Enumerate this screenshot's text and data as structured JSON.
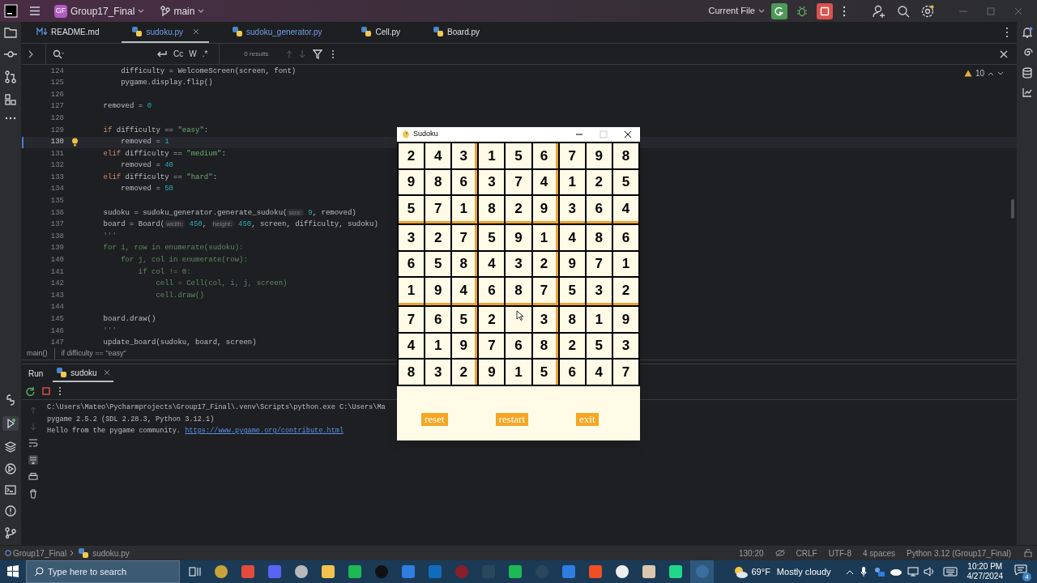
{
  "titlebar": {
    "project_badge": "GF",
    "project": "Group17_Final",
    "branch": "main",
    "run_config": "Current File"
  },
  "tabs": [
    {
      "label": "README.md",
      "kind": "markdown",
      "selected": false
    },
    {
      "label": "sudoku.py",
      "kind": "python",
      "selected": true
    },
    {
      "label": "sudoku_generator.py",
      "kind": "python",
      "selected": false
    },
    {
      "label": "Cell.py",
      "kind": "python",
      "selected": false
    },
    {
      "label": "Board.py",
      "kind": "python",
      "selected": false
    }
  ],
  "find_bar": {
    "options": [
      "Cc",
      "W",
      ".*"
    ],
    "results": "0 results"
  },
  "editor": {
    "warnings": "10",
    "lines": [
      {
        "number": "124",
        "tokens": [
          {
            "kind": "code",
            "text": "        difficulty = WelcomeScreen(screen, font)"
          }
        ]
      },
      {
        "number": "125",
        "tokens": [
          {
            "kind": "code",
            "text": "        pygame.display.flip()"
          }
        ]
      },
      {
        "number": "126"
      },
      {
        "number": "127",
        "tokens": [
          {
            "kind": "code",
            "text": "    removed = "
          },
          {
            "kind": "number",
            "text": "0"
          }
        ]
      },
      {
        "number": "128"
      },
      {
        "number": "129",
        "tokens": [
          {
            "kind": "keyword",
            "text": "    if"
          },
          {
            "kind": "code",
            "text": " difficulty == "
          },
          {
            "kind": "string",
            "text": "\"easy\""
          },
          {
            "kind": "code",
            "text": ":"
          }
        ]
      },
      {
        "number": "130",
        "current": true,
        "tokens": [
          {
            "kind": "code",
            "text": "        removed = "
          },
          {
            "kind": "number",
            "text": "1"
          }
        ]
      },
      {
        "number": "131",
        "tokens": [
          {
            "kind": "keyword",
            "text": "    elif"
          },
          {
            "kind": "code",
            "text": " difficulty == "
          },
          {
            "kind": "string",
            "text": "\"medium\""
          },
          {
            "kind": "code",
            "text": ":"
          }
        ]
      },
      {
        "number": "132",
        "tokens": [
          {
            "kind": "code",
            "text": "        removed = "
          },
          {
            "kind": "number",
            "text": "40"
          }
        ]
      },
      {
        "number": "133",
        "tokens": [
          {
            "kind": "keyword",
            "text": "    elif"
          },
          {
            "kind": "code",
            "text": " difficulty == "
          },
          {
            "kind": "string",
            "text": "\"hard\""
          },
          {
            "kind": "code",
            "text": ":"
          }
        ]
      },
      {
        "number": "134",
        "tokens": [
          {
            "kind": "code",
            "text": "        removed = "
          },
          {
            "kind": "number",
            "text": "50"
          }
        ]
      },
      {
        "number": "135"
      },
      {
        "number": "136",
        "tokens": [
          {
            "kind": "code",
            "text": "    sudoku = sudoku_generator.generate_sudoku("
          },
          {
            "kind": "hint",
            "text": "size:"
          },
          {
            "kind": "number",
            "text": " 9"
          },
          {
            "kind": "code",
            "text": ", removed)"
          }
        ]
      },
      {
        "number": "137",
        "tokens": [
          {
            "kind": "code",
            "text": "    board = Board("
          },
          {
            "kind": "hint",
            "text": "width:"
          },
          {
            "kind": "number",
            "text": " 450"
          },
          {
            "kind": "code",
            "text": ", "
          },
          {
            "kind": "hint",
            "text": "height:"
          },
          {
            "kind": "number",
            "text": " 450"
          },
          {
            "kind": "code",
            "text": ", screen, difficulty, sudoku)"
          }
        ]
      },
      {
        "number": "138",
        "tokens": [
          {
            "kind": "docstring",
            "text": "    '''"
          }
        ]
      },
      {
        "number": "139",
        "tokens": [
          {
            "kind": "docstring",
            "text": "    for i, row in enumerate(sudoku):"
          }
        ]
      },
      {
        "number": "140",
        "tokens": [
          {
            "kind": "docstring",
            "text": "        for j, col in enumerate(row):"
          }
        ]
      },
      {
        "number": "141",
        "tokens": [
          {
            "kind": "docstring",
            "text": "            if col != 0:"
          }
        ]
      },
      {
        "number": "142",
        "tokens": [
          {
            "kind": "docstring",
            "text": "                cell = Cell(col, i, j, screen)"
          }
        ]
      },
      {
        "number": "143",
        "tokens": [
          {
            "kind": "docstring",
            "text": "                cell.draw()"
          }
        ]
      },
      {
        "number": "144"
      },
      {
        "number": "145",
        "tokens": [
          {
            "kind": "code",
            "text": "    board.draw()"
          }
        ]
      },
      {
        "number": "146",
        "tokens": [
          {
            "kind": "docstring",
            "text": "    '''"
          }
        ]
      },
      {
        "number": "147",
        "tokens": [
          {
            "kind": "code",
            "text": "    update_board(sudoku, board, screen)"
          }
        ]
      }
    ]
  },
  "breadcrumb": [
    "main()",
    "if difficulty == \"easy\""
  ],
  "run_panel": {
    "tabs": [
      {
        "label": "Run",
        "kind": "title"
      },
      {
        "label": "sudoku",
        "kind": "config"
      }
    ],
    "console": [
      [
        {
          "kind": "text",
          "text": "C:\\Users\\Mateo\\Pycharmprojects\\Group17_Final\\.venv\\Scripts\\python.exe C:\\Users\\Ma"
        }
      ],
      [
        {
          "kind": "text",
          "text": "pygame 2.5.2 (SDL 2.28.3, Python 3.12.1)"
        }
      ],
      [
        {
          "kind": "text",
          "text": "Hello from the pygame community. "
        },
        {
          "kind": "link",
          "text": "https://www.pygame.org/contribute.html"
        }
      ]
    ]
  },
  "status_bar": {
    "path": [
      "Group17_Final",
      "sudoku.py"
    ],
    "items": [
      "130:20",
      "CRLF",
      "UTF-8",
      "4 spaces",
      "Python 3.12 (Group17_Final)"
    ]
  },
  "sudoku_window": {
    "title": "Sudoku",
    "grid": [
      [
        {
          "kind": "digit",
          "value": "2"
        },
        {
          "kind": "digit",
          "value": "4"
        },
        {
          "kind": "digit",
          "value": "3"
        },
        {
          "kind": "digit",
          "value": "1"
        },
        {
          "kind": "digit",
          "value": "5"
        },
        {
          "kind": "digit",
          "value": "6"
        },
        {
          "kind": "digit",
          "value": "7"
        },
        {
          "kind": "digit",
          "value": "9"
        },
        {
          "kind": "digit",
          "value": "8"
        }
      ],
      [
        {
          "kind": "digit",
          "value": "9"
        },
        {
          "kind": "digit",
          "value": "8"
        },
        {
          "kind": "digit",
          "value": "6"
        },
        {
          "kind": "digit",
          "value": "3"
        },
        {
          "kind": "digit",
          "value": "7"
        },
        {
          "kind": "digit",
          "value": "4"
        },
        {
          "kind": "digit",
          "value": "1"
        },
        {
          "kind": "digit",
          "value": "2"
        },
        {
          "kind": "digit",
          "value": "5"
        }
      ],
      [
        {
          "kind": "digit",
          "value": "5"
        },
        {
          "kind": "digit",
          "value": "7"
        },
        {
          "kind": "digit",
          "value": "1"
        },
        {
          "kind": "digit",
          "value": "8"
        },
        {
          "kind": "digit",
          "value": "2"
        },
        {
          "kind": "digit",
          "value": "9"
        },
        {
          "kind": "digit",
          "value": "3"
        },
        {
          "kind": "digit",
          "value": "6"
        },
        {
          "kind": "digit",
          "value": "4"
        }
      ],
      [
        {
          "kind": "digit",
          "value": "3"
        },
        {
          "kind": "digit",
          "value": "2"
        },
        {
          "kind": "digit",
          "value": "7"
        },
        {
          "kind": "digit",
          "value": "5"
        },
        {
          "kind": "digit",
          "value": "9"
        },
        {
          "kind": "digit",
          "value": "1"
        },
        {
          "kind": "digit",
          "value": "4"
        },
        {
          "kind": "digit",
          "value": "8"
        },
        {
          "kind": "digit",
          "value": "6"
        }
      ],
      [
        {
          "kind": "digit",
          "value": "6"
        },
        {
          "kind": "digit",
          "value": "5"
        },
        {
          "kind": "digit",
          "value": "8"
        },
        {
          "kind": "digit",
          "value": "4"
        },
        {
          "kind": "digit",
          "value": "3"
        },
        {
          "kind": "digit",
          "value": "2"
        },
        {
          "kind": "digit",
          "value": "9"
        },
        {
          "kind": "digit",
          "value": "7"
        },
        {
          "kind": "digit",
          "value": "1"
        }
      ],
      [
        {
          "kind": "digit",
          "value": "1"
        },
        {
          "kind": "digit",
          "value": "9"
        },
        {
          "kind": "digit",
          "value": "4"
        },
        {
          "kind": "digit",
          "value": "6"
        },
        {
          "kind": "digit",
          "value": "8"
        },
        {
          "kind": "digit",
          "value": "7"
        },
        {
          "kind": "digit",
          "value": "5"
        },
        {
          "kind": "digit",
          "value": "3"
        },
        {
          "kind": "digit",
          "value": "2"
        }
      ],
      [
        {
          "kind": "digit",
          "value": "7"
        },
        {
          "kind": "digit",
          "value": "6"
        },
        {
          "kind": "digit",
          "value": "5"
        },
        {
          "kind": "digit",
          "value": "2"
        },
        {
          "kind": "empty"
        },
        {
          "kind": "digit",
          "value": "3"
        },
        {
          "kind": "digit",
          "value": "8"
        },
        {
          "kind": "digit",
          "value": "1"
        },
        {
          "kind": "digit",
          "value": "9"
        }
      ],
      [
        {
          "kind": "digit",
          "value": "4"
        },
        {
          "kind": "digit",
          "value": "1"
        },
        {
          "kind": "digit",
          "value": "9"
        },
        {
          "kind": "digit",
          "value": "7"
        },
        {
          "kind": "digit",
          "value": "6"
        },
        {
          "kind": "digit",
          "value": "8"
        },
        {
          "kind": "digit",
          "value": "2"
        },
        {
          "kind": "digit",
          "value": "5"
        },
        {
          "kind": "digit",
          "value": "3"
        }
      ],
      [
        {
          "kind": "digit",
          "value": "8"
        },
        {
          "kind": "digit",
          "value": "3"
        },
        {
          "kind": "digit",
          "value": "2"
        },
        {
          "kind": "digit",
          "value": "9"
        },
        {
          "kind": "digit",
          "value": "1"
        },
        {
          "kind": "digit",
          "value": "5"
        },
        {
          "kind": "digit",
          "value": "6"
        },
        {
          "kind": "digit",
          "value": "4"
        },
        {
          "kind": "digit",
          "value": "7"
        }
      ]
    ],
    "buttons": [
      "reset",
      "restart",
      "exit"
    ]
  },
  "taskbar": {
    "search_placeholder": "Type here to search",
    "temperature": "69°F",
    "weather": "Mostly cloudy",
    "time": "10:20 PM",
    "date": "4/27/2024",
    "notifications": "4"
  }
}
